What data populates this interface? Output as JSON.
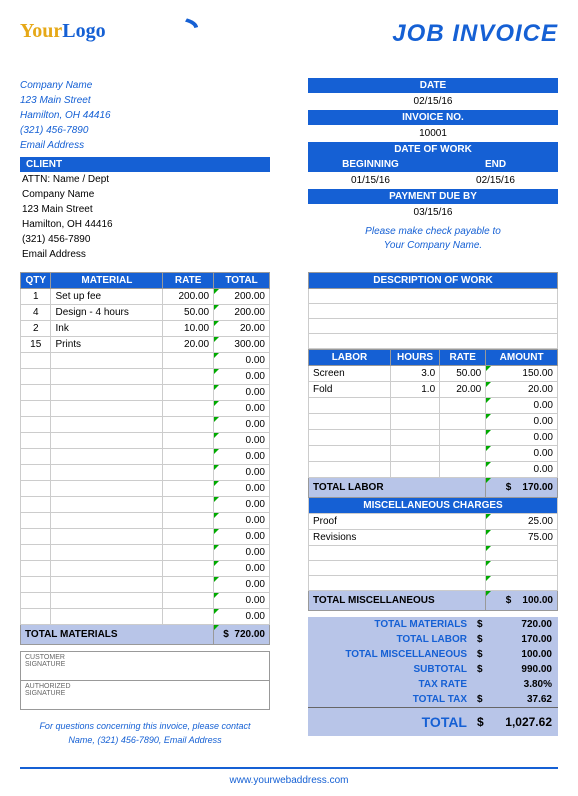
{
  "title": "JOB INVOICE",
  "logo": {
    "your": "Your",
    "logo": "Logo"
  },
  "company": {
    "name": "Company Name",
    "street": "123 Main Street",
    "citystate": "Hamilton, OH  44416",
    "phone": "(321) 456-7890",
    "email": "Email Address"
  },
  "headers": {
    "date": "DATE",
    "invoice_no": "INVOICE NO.",
    "date_of_work": "DATE OF WORK",
    "beginning": "BEGINNING",
    "end": "END",
    "payment_due": "PAYMENT DUE BY",
    "client": "CLIENT",
    "qty": "QTY",
    "material": "MATERIAL",
    "rate": "RATE",
    "total": "TOTAL",
    "desc_work": "DESCRIPTION OF WORK",
    "labor": "LABOR",
    "hours": "HOURS",
    "amount": "AMOUNT",
    "misc": "MISCELLANEOUS CHARGES",
    "total_materials": "TOTAL MATERIALS",
    "total_labor": "TOTAL LABOR",
    "total_misc": "TOTAL MISCELLANEOUS",
    "subtotal": "SUBTOTAL",
    "tax_rate": "TAX RATE",
    "total_tax": "TOTAL TAX",
    "grand_total": "TOTAL",
    "customer_sig": "CUSTOMER SIGNATURE",
    "auth_sig": "AUTHORIZED SIGNATURE"
  },
  "meta": {
    "date": "02/15/16",
    "invoice_no": "10001",
    "beginning": "01/15/16",
    "end": "02/15/16",
    "payment_due": "03/15/16"
  },
  "payable": {
    "line1": "Please make check payable to",
    "line2": "Your Company Name."
  },
  "client": {
    "attn": "ATTN: Name / Dept",
    "name": "Company Name",
    "street": "123 Main Street",
    "citystate": "Hamilton, OH  44416",
    "phone": "(321) 456-7890",
    "email": "Email Address"
  },
  "materials": [
    {
      "qty": "1",
      "desc": "Set up fee",
      "rate": "200.00",
      "total": "200.00"
    },
    {
      "qty": "4",
      "desc": "Design - 4 hours",
      "rate": "50.00",
      "total": "200.00"
    },
    {
      "qty": "2",
      "desc": "Ink",
      "rate": "10.00",
      "total": "20.00"
    },
    {
      "qty": "15",
      "desc": "Prints",
      "rate": "20.00",
      "total": "300.00"
    }
  ],
  "materials_blank_rows": 17,
  "materials_total": "720.00",
  "labor": [
    {
      "desc": "Screen",
      "hours": "3.0",
      "rate": "50.00",
      "amount": "150.00"
    },
    {
      "desc": "Fold",
      "hours": "1.0",
      "rate": "20.00",
      "amount": "20.00"
    }
  ],
  "labor_blank_rows": 5,
  "labor_total": "170.00",
  "misc": [
    {
      "desc": "Proof",
      "amount": "25.00"
    },
    {
      "desc": "Revisions",
      "amount": "75.00"
    }
  ],
  "misc_blank_rows": 3,
  "misc_total": "100.00",
  "summary": {
    "total_materials": "720.00",
    "total_labor": "170.00",
    "total_misc": "100.00",
    "subtotal": "990.00",
    "tax_rate": "3.80%",
    "total_tax": "37.62",
    "grand_total": "1,027.62"
  },
  "contact": {
    "line1": "For questions concerning this invoice, please contact",
    "line2": "Name, (321) 456-7890, Email Address"
  },
  "footer": "www.yourwebaddress.com",
  "currency": "$"
}
